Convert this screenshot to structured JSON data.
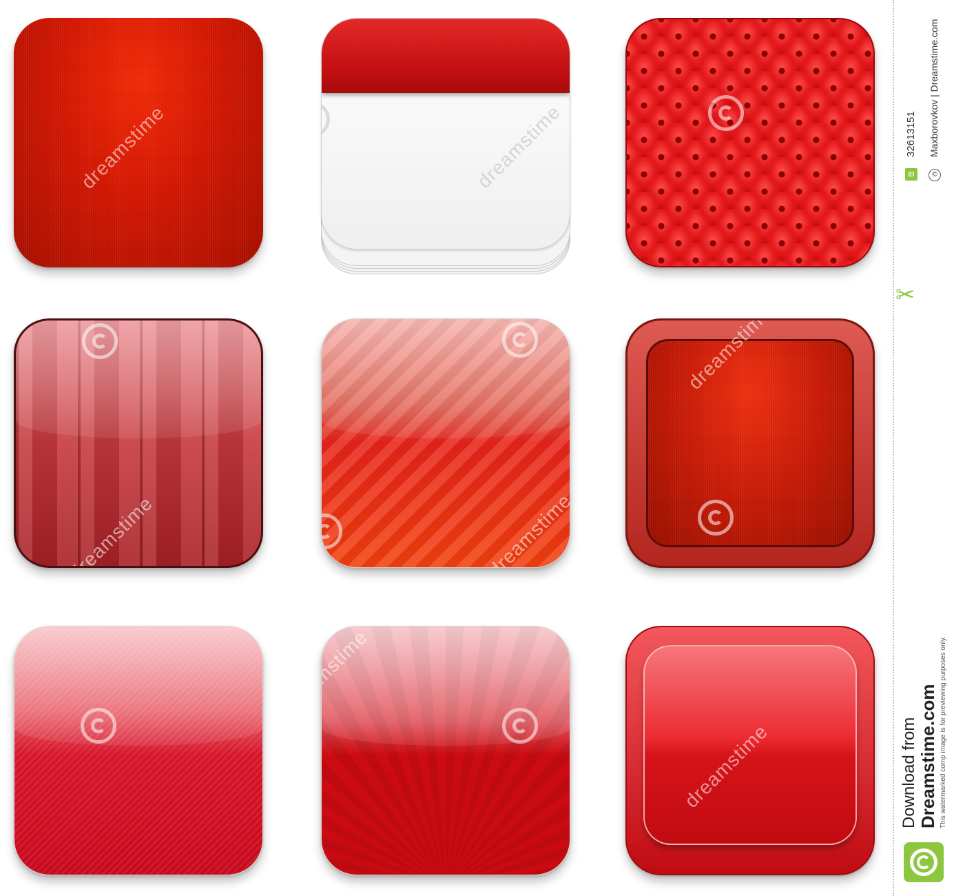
{
  "watermark": {
    "brand": "dreamstime"
  },
  "sidebar": {
    "image_id_label": "ID",
    "image_id": "32613151",
    "credit": "Maxborovkov | Dreamstime.com",
    "copyright_symbol": "©",
    "download_line1": "Download from",
    "download_line2": "Dreamstime.com",
    "disclaimer": "This watermarked comp image is for previewing purposes only."
  },
  "tiles": [
    {
      "name": "red linen icon"
    },
    {
      "name": "red calendar icon"
    },
    {
      "name": "red tufted leather icon"
    },
    {
      "name": "red curtain icon"
    },
    {
      "name": "red striped glossy icon"
    },
    {
      "name": "red framed linen icon"
    },
    {
      "name": "red fine-striped glossy icon"
    },
    {
      "name": "red rays glossy icon"
    },
    {
      "name": "red glossy framed icon"
    }
  ],
  "colors": {
    "primary_red": "#d41702",
    "accent_green": "#8dc63f"
  }
}
